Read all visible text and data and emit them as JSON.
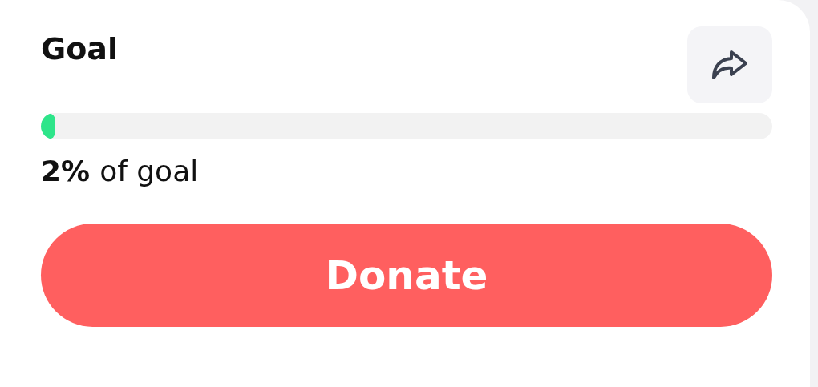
{
  "goal": {
    "title": "Goal",
    "progress": {
      "level": 0.02
    },
    "percent": "2%",
    "percent_suffix": "of goal"
  },
  "donate_button": {
    "label": "Donate"
  }
}
